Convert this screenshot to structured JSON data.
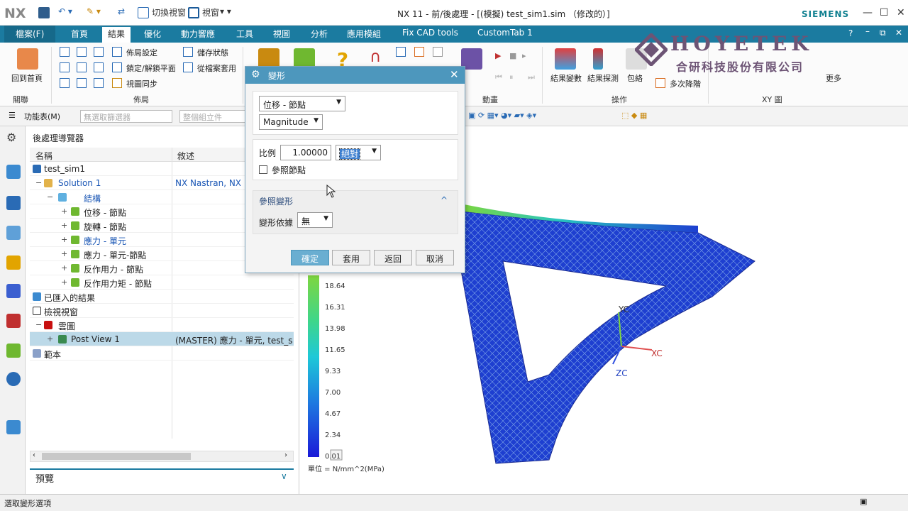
{
  "titlebar": {
    "logo": "NX",
    "switch_window": "切換視窗",
    "window": "視窗",
    "title": "NX 11 - 前/後處理 - [(模擬) test_sim1.sim （修改的）]",
    "brand": "SIEMENS"
  },
  "menu": {
    "file": "檔案(F)",
    "tabs": [
      "首頁",
      "結果",
      "優化",
      "動力響應",
      "工具",
      "視圖",
      "分析",
      "應用模組",
      "Fix CAD tools",
      "CustomTab 1"
    ],
    "active": "結果"
  },
  "ribbon": {
    "home": "回到首頁",
    "group_context": "關聯",
    "group_layout": "佈局",
    "layout_settings": "佈局設定",
    "lock_unlock": "鎖定/解鎖平面",
    "view_sync": "視圖同步",
    "save_state": "儲存狀態",
    "apply_from_file": "從檔案套用",
    "group_animation": "動畫",
    "result_vars": "結果變數",
    "result_probe": "結果探測",
    "envelope": "包絡",
    "multi_reduce": "多次降階",
    "group_ops": "操作",
    "group_xy": "XY 圖",
    "more": "更多"
  },
  "toolbar2": {
    "menu": "功能表(M)",
    "filter_placeholder": "無選取篩選器",
    "assembly_placeholder": "整個組立件"
  },
  "navigator": {
    "title": "後處理導覽器",
    "col_name": "名稱",
    "col_desc": "敘述",
    "rows": [
      {
        "name": "test_sim1",
        "desc": ""
      },
      {
        "name": "Solution 1",
        "desc": "NX Nastran, NX N"
      },
      {
        "name": "結構",
        "desc": ""
      },
      {
        "name": "位移 - 節點",
        "desc": ""
      },
      {
        "name": "旋轉 - 節點",
        "desc": ""
      },
      {
        "name": "應力 - 單元",
        "desc": ""
      },
      {
        "name": "應力 - 單元-節點",
        "desc": ""
      },
      {
        "name": "反作用力 - 節點",
        "desc": ""
      },
      {
        "name": "反作用力矩 - 節點",
        "desc": ""
      },
      {
        "name": "已匯入的結果",
        "desc": ""
      },
      {
        "name": "檢視視窗",
        "desc": ""
      },
      {
        "name": "雲圖",
        "desc": ""
      },
      {
        "name": "Post View 1",
        "desc": "(MASTER) 應力 - 單元, test_sim"
      },
      {
        "name": "範本",
        "desc": ""
      }
    ],
    "preview": "預覽"
  },
  "dialog": {
    "title": "變形",
    "result_type": "位移 - 節點",
    "component": "Magnitude",
    "scale_label": "比例",
    "scale_value": "1.00000",
    "scale_mode": "絕對",
    "ref_node": "參照節點",
    "section": "參照變形",
    "deform_by_label": "變形依據",
    "deform_by_value": "無",
    "ok": "確定",
    "apply": "套用",
    "back": "返回",
    "cancel": "取消"
  },
  "legend": {
    "values": [
      "18.64",
      "16.31",
      "13.98",
      "11.65",
      "9.33",
      "7.00",
      "4.67",
      "2.34",
      "0.01"
    ],
    "unit": "單位 = N/mm^2(MPa)"
  },
  "axes": {
    "yc": "YC",
    "xc": "XC",
    "zc": "ZC"
  },
  "watermark": {
    "name": "HOYETEK",
    "company": "合研科技股份有限公司"
  },
  "status": "選取變形選項",
  "colors": {
    "ribbon_blue": "#1b7ba0",
    "dialog_title": "#4d97bd",
    "mesh_blue": "#1e3fd0"
  }
}
